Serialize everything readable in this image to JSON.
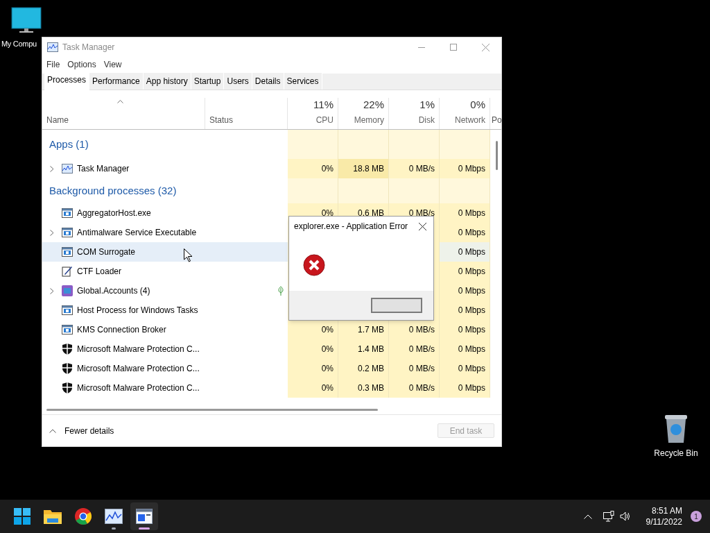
{
  "desktop_icons": [
    {
      "label": "My Compu",
      "kind": "computer"
    },
    {
      "label": "Recycle Bin",
      "kind": "recycle"
    }
  ],
  "window": {
    "title": "Task Manager"
  },
  "menu": [
    "File",
    "Options",
    "View"
  ],
  "tabs": [
    {
      "label": "Processes",
      "selected": true
    },
    {
      "label": "Performance",
      "selected": false
    },
    {
      "label": "App history",
      "selected": false
    },
    {
      "label": "Startup",
      "selected": false
    },
    {
      "label": "Users",
      "selected": false
    },
    {
      "label": "Details",
      "selected": false
    },
    {
      "label": "Services",
      "selected": false
    }
  ],
  "columns": [
    {
      "name": "Name"
    },
    {
      "name": "Status"
    },
    {
      "percent": "11%",
      "name": "CPU"
    },
    {
      "percent": "22%",
      "name": "Memory"
    },
    {
      "percent": "1%",
      "name": "Disk"
    },
    {
      "percent": "0%",
      "name": "Network"
    },
    {
      "name": "Po"
    }
  ],
  "rows": [
    {
      "kind": "group",
      "label": "Apps (1)"
    },
    {
      "kind": "app",
      "name": "Task Manager",
      "expandable": true,
      "selected": false,
      "efficiency": false,
      "cpu": "0%",
      "memory": "18.8 MB",
      "disk": "0 MB/s",
      "network": "0 Mbps"
    },
    {
      "kind": "group",
      "label": "Background processes (32)"
    },
    {
      "kind": "service",
      "name": "AggregatorHost.exe",
      "expandable": false,
      "selected": false,
      "efficiency": false,
      "cpu": "0%",
      "memory": "0.6 MB",
      "disk": "0 MB/s",
      "network": "0 Mbps"
    },
    {
      "kind": "service",
      "name": "Antimalware Service Executable",
      "expandable": true,
      "selected": false,
      "efficiency": false,
      "network": "0 Mbps"
    },
    {
      "kind": "service",
      "name": "COM Surrogate",
      "expandable": false,
      "selected": true,
      "efficiency": false,
      "network": "0 Mbps"
    },
    {
      "kind": "editor",
      "name": "CTF Loader",
      "expandable": false,
      "selected": false,
      "efficiency": false,
      "network": "0 Mbps"
    },
    {
      "kind": "accounts",
      "name": "Global.Accounts (4)",
      "expandable": true,
      "selected": false,
      "efficiency": true,
      "network": "0 Mbps"
    },
    {
      "kind": "service",
      "name": "Host Process for Windows Tasks",
      "expandable": false,
      "selected": false,
      "efficiency": false,
      "network": "0 Mbps"
    },
    {
      "kind": "service",
      "name": "KMS Connection Broker",
      "expandable": false,
      "selected": false,
      "efficiency": false,
      "cpu": "0%",
      "memory": "1.7 MB",
      "disk": "0 MB/s",
      "network": "0 Mbps"
    },
    {
      "kind": "defender",
      "name": "Microsoft Malware Protection C...",
      "expandable": false,
      "selected": false,
      "efficiency": false,
      "cpu": "0%",
      "memory": "1.4 MB",
      "disk": "0 MB/s",
      "network": "0 Mbps"
    },
    {
      "kind": "defender",
      "name": "Microsoft Malware Protection C...",
      "expandable": false,
      "selected": false,
      "efficiency": false,
      "cpu": "0%",
      "memory": "0.2 MB",
      "disk": "0 MB/s",
      "network": "0 Mbps"
    },
    {
      "kind": "defender",
      "name": "Microsoft Malware Protection C...",
      "expandable": false,
      "selected": false,
      "efficiency": false,
      "cpu": "0%",
      "memory": "0.3 MB",
      "disk": "0 MB/s",
      "network": "0 Mbps"
    }
  ],
  "footer": {
    "details_link": "Fewer details",
    "end_task": {
      "label": "End task",
      "disabled": true
    }
  },
  "dialog": {
    "title": "explorer.exe - Application Error"
  },
  "taskbar": {
    "apps": [
      {
        "kind": "start",
        "active": false,
        "running": false
      },
      {
        "kind": "folder",
        "active": false,
        "running": false
      },
      {
        "kind": "chrome",
        "active": false,
        "running": false
      },
      {
        "kind": "taskmgr",
        "active": false,
        "running": true
      },
      {
        "kind": "window",
        "active": true,
        "running": true
      }
    ],
    "time": "8:51 AM",
    "date": "9/11/2022",
    "notifications": "1"
  }
}
